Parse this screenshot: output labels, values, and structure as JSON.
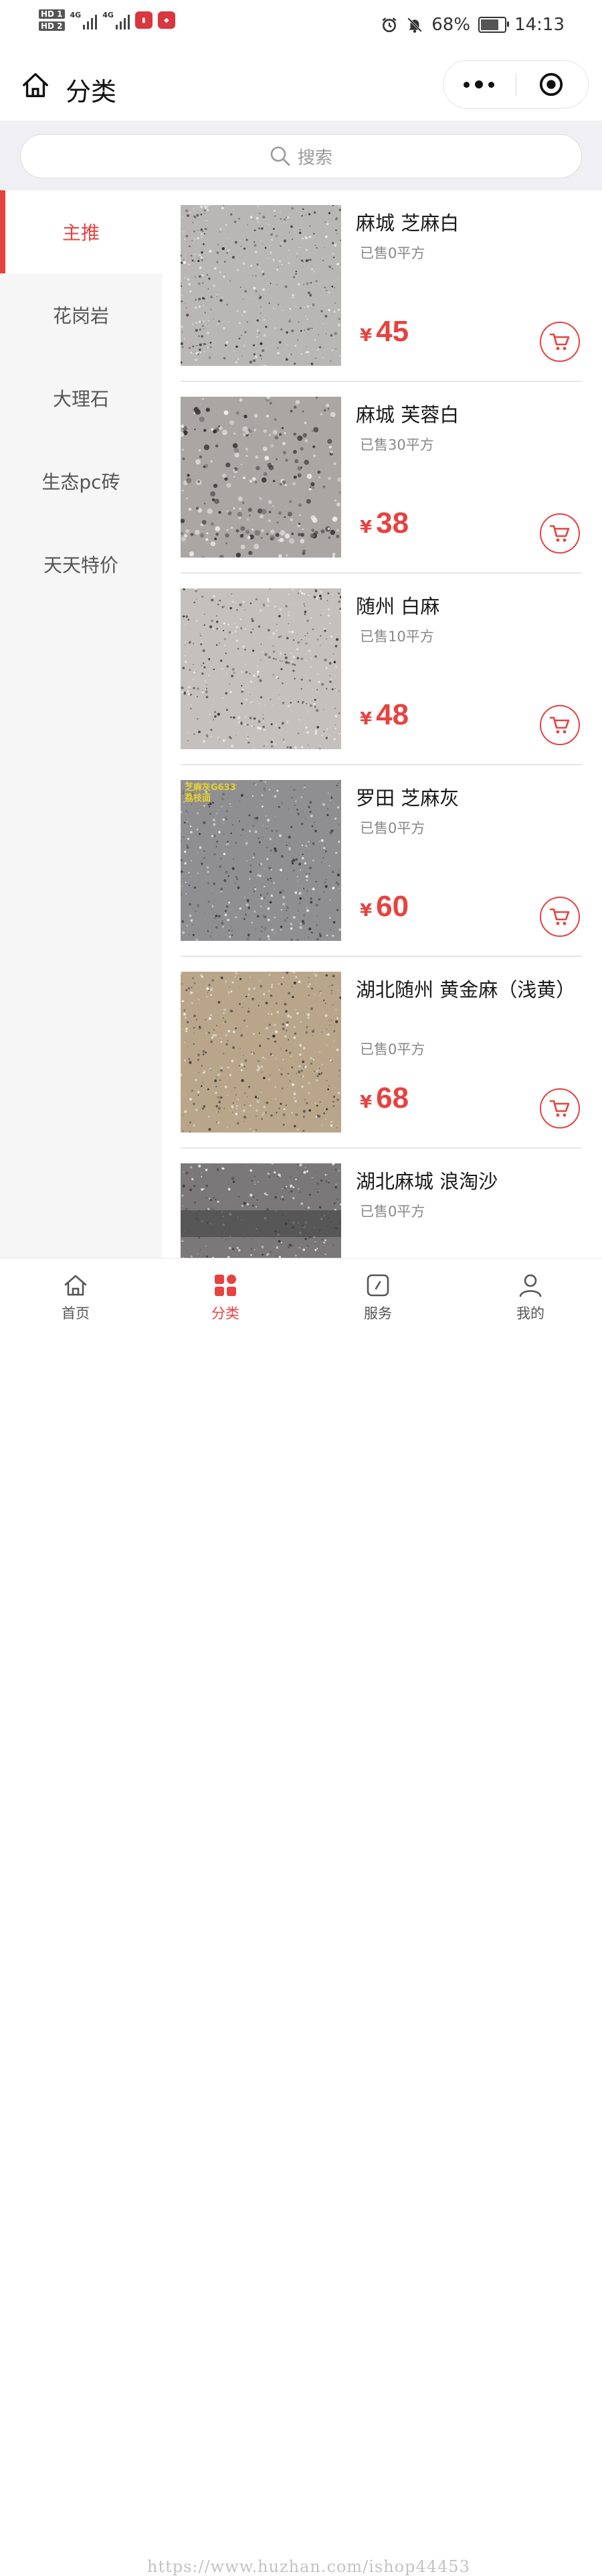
{
  "status_bar": {
    "hd1": "HD 1",
    "hd2": "HD 2",
    "net1": "4G",
    "net2": "4G",
    "battery": "68%",
    "time": "14:13"
  },
  "nav": {
    "title": "分类"
  },
  "search": {
    "placeholder": "搜索"
  },
  "categories": [
    {
      "label": "主推",
      "active": true
    },
    {
      "label": "花岗岩",
      "active": false
    },
    {
      "label": "大理石",
      "active": false
    },
    {
      "label": "生态pc砖",
      "active": false
    },
    {
      "label": "天天特价",
      "active": false
    }
  ],
  "products": [
    {
      "name": "麻城 芝麻白",
      "sold": "已售0平方",
      "currency": "¥",
      "price": "45",
      "swatch": "#b9b7b5"
    },
    {
      "name": "麻城 芙蓉白",
      "sold": "已售30平方",
      "currency": "¥",
      "price": "38",
      "swatch": "#a9a6a4"
    },
    {
      "name": "随州 白麻",
      "sold": "已售10平方",
      "currency": "¥",
      "price": "48",
      "swatch": "#c3c0be"
    },
    {
      "name": "罗田 芝麻灰",
      "sold": "已售0平方",
      "currency": "¥",
      "price": "60",
      "swatch": "#8f8f91",
      "overlay": "芝麻灰G633\n荔枝面"
    },
    {
      "name": "湖北随州 黄金麻（浅黄）",
      "sold": "已售0平方",
      "currency": "¥",
      "price": "68",
      "swatch": "#b9a68a"
    },
    {
      "name": "湖北麻城 浪淘沙",
      "sold": "已售0平方",
      "currency": "¥",
      "price": "",
      "swatch": "#7a7878"
    }
  ],
  "tabbar": [
    {
      "label": "首页",
      "icon": "home-icon",
      "active": false
    },
    {
      "label": "分类",
      "icon": "category-icon",
      "active": true
    },
    {
      "label": "服务",
      "icon": "compass-icon",
      "active": false
    },
    {
      "label": "我的",
      "icon": "user-icon",
      "active": false
    }
  ],
  "watermark": "https://www.huzhan.com/ishop44453",
  "colors": {
    "accent": "#e64340",
    "sidebar_bg": "#f6f6f6",
    "search_bg": "#efeff4"
  }
}
